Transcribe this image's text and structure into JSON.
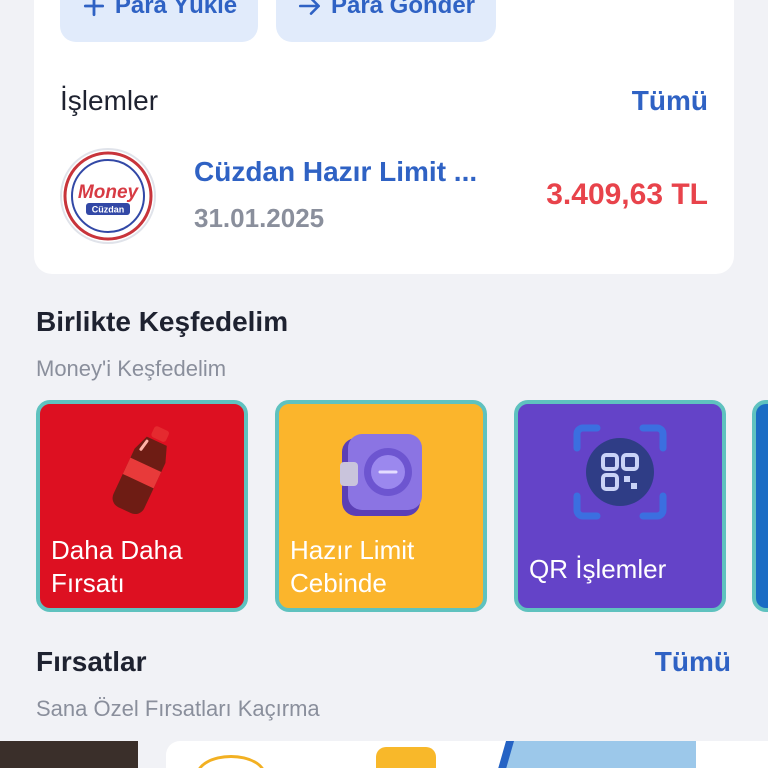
{
  "actions": {
    "load_money": "Para Yükle",
    "send_money": "Para Gönder"
  },
  "transactions": {
    "title": "İşlemler",
    "see_all": "Tümü",
    "items": [
      {
        "title": "Cüzdan Hazır Limit ...",
        "date": "31.01.2025",
        "amount": "3.409,63 TL",
        "logo_text_top": "Money",
        "logo_text_bottom": "Cüzdan"
      }
    ]
  },
  "discover": {
    "title": "Birlikte Keşfedelim",
    "subtitle": "Money'i Keşfedelim",
    "tiles": [
      {
        "label_line1": "Daha Daha",
        "label_line2": "Fırsatı",
        "icon": "soda-bottle-icon",
        "color": "#dd1021"
      },
      {
        "label_line1": "Hazır Limit",
        "label_line2": "Cebinde",
        "icon": "wallet-safe-icon",
        "color": "#fbb52c"
      },
      {
        "label_line1": "QR İşlemler",
        "label_line2": "",
        "icon": "qr-code-icon",
        "color": "#6443c8"
      }
    ]
  },
  "offers": {
    "title": "Fırsatlar",
    "see_all": "Tümü",
    "subtitle": "Sana Özel Fırsatları Kaçırma"
  },
  "colors": {
    "accent": "#2f62c4",
    "amount": "#e8434b",
    "background": "#f1f2f6"
  }
}
